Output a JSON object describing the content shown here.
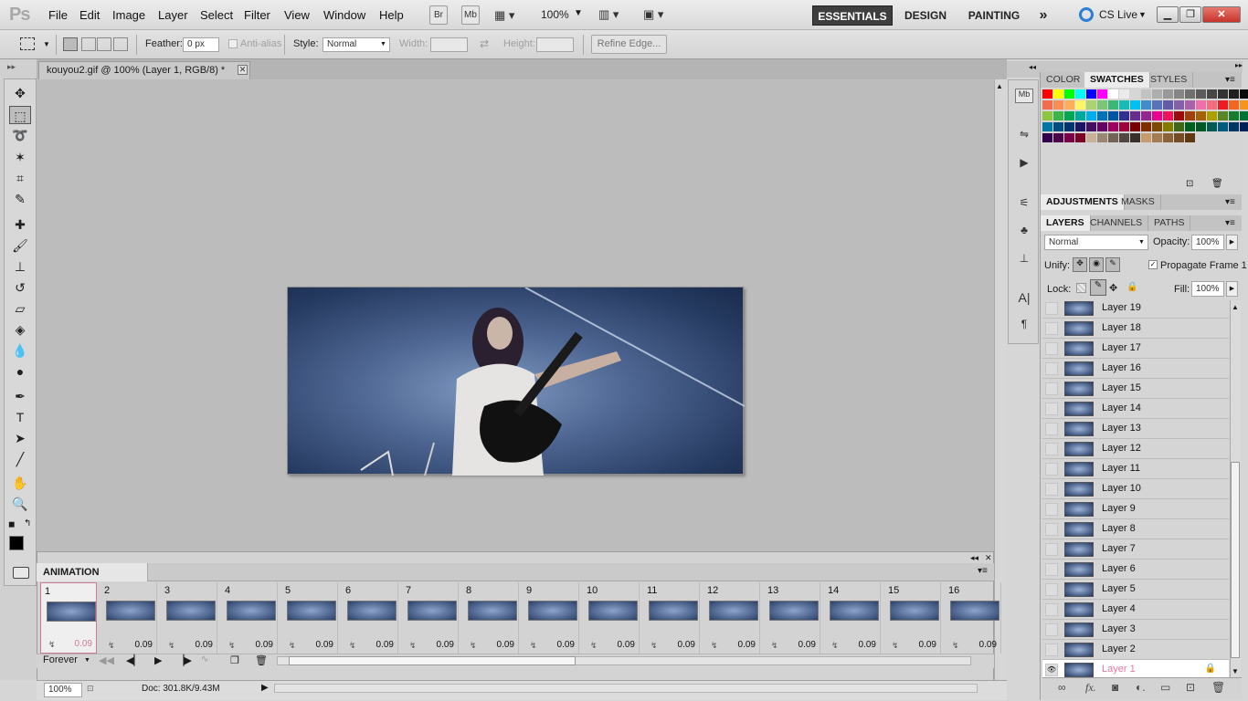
{
  "app": {
    "logo": "Ps"
  },
  "menu": {
    "items": [
      "File",
      "Edit",
      "Image",
      "Layer",
      "Select",
      "Filter",
      "View",
      "Window",
      "Help"
    ]
  },
  "appbar": {
    "bridge": "Br",
    "minibridge": "Mb",
    "zoom": "100%"
  },
  "workspaces": {
    "essentials": "ESSENTIALS",
    "design": "DESIGN",
    "painting": "PAINTING",
    "more": "»",
    "cslive": "CS Live"
  },
  "options": {
    "feather_label": "Feather:",
    "feather_value": "0 px",
    "antialias_label": "Anti-alias",
    "style_label": "Style:",
    "style_value": "Normal",
    "width_label": "Width:",
    "height_label": "Height:",
    "refine_edge": "Refine Edge..."
  },
  "document": {
    "tab_title": "kouyou2.gif @ 100% (Layer 1, RGB/8) *"
  },
  "status": {
    "zoom": "100%",
    "doc": "Doc: 301.8K/9.43M"
  },
  "animation": {
    "title": "ANIMATION (FRAMES)",
    "loop": "Forever",
    "frames": [
      {
        "n": "1",
        "delay": "0.09"
      },
      {
        "n": "2",
        "delay": "0.09"
      },
      {
        "n": "3",
        "delay": "0.09"
      },
      {
        "n": "4",
        "delay": "0.09"
      },
      {
        "n": "5",
        "delay": "0.09"
      },
      {
        "n": "6",
        "delay": "0.09"
      },
      {
        "n": "7",
        "delay": "0.09"
      },
      {
        "n": "8",
        "delay": "0.09"
      },
      {
        "n": "9",
        "delay": "0.09"
      },
      {
        "n": "10",
        "delay": "0.09"
      },
      {
        "n": "11",
        "delay": "0.09"
      },
      {
        "n": "12",
        "delay": "0.09"
      },
      {
        "n": "13",
        "delay": "0.09"
      },
      {
        "n": "14",
        "delay": "0.09"
      },
      {
        "n": "15",
        "delay": "0.09"
      },
      {
        "n": "16",
        "delay": "0.09"
      }
    ]
  },
  "panels": {
    "color_tab": "COLOR",
    "swatches_tab": "SWATCHES",
    "styles_tab": "STYLES",
    "adjustments_tab": "ADJUSTMENTS",
    "masks_tab": "MASKS",
    "layers_tab": "LAYERS",
    "channels_tab": "CHANNELS",
    "paths_tab": "PATHS"
  },
  "layers": {
    "blend_mode": "Normal",
    "opacity_label": "Opacity:",
    "opacity_value": "100%",
    "unify_label": "Unify:",
    "propagate_label": "Propagate Frame 1",
    "lock_label": "Lock:",
    "fill_label": "Fill:",
    "fill_value": "100%",
    "items": [
      "Layer 19",
      "Layer 18",
      "Layer 17",
      "Layer 16",
      "Layer 15",
      "Layer 14",
      "Layer 13",
      "Layer 12",
      "Layer 11",
      "Layer 10",
      "Layer 9",
      "Layer 8",
      "Layer 7",
      "Layer 6",
      "Layer 5",
      "Layer 4",
      "Layer 3",
      "Layer 2",
      "Layer 1"
    ],
    "active": "Layer 1"
  },
  "swatch_colors": [
    "#ff0000",
    "#ffff00",
    "#00ff00",
    "#00ffff",
    "#0000ff",
    "#ff00ff",
    "#ffffff",
    "#ebebeb",
    "#d6d6d6",
    "#c2c2c2",
    "#adadad",
    "#999999",
    "#858585",
    "#707070",
    "#5c5c5c",
    "#474747",
    "#333333",
    "#1f1f1f",
    "#0a0a0a",
    "#000000",
    "#f26c4f",
    "#f68e56",
    "#fbaf5d",
    "#fff568",
    "#acd372",
    "#7cc576",
    "#3bb878",
    "#1abbb4",
    "#00bff3",
    "#438ccb",
    "#5574b9",
    "#605ca8",
    "#855fa8",
    "#a763a8",
    "#f06eaa",
    "#f26d7d",
    "#ed1c24",
    "#f26522",
    "#f7941d",
    "#fff200",
    "#8dc63f",
    "#39b54a",
    "#00a651",
    "#00a99d",
    "#00aeef",
    "#0072bc",
    "#0054a6",
    "#2e3192",
    "#662d91",
    "#92278f",
    "#ec008c",
    "#ed145b",
    "#9e0b0f",
    "#a0410d",
    "#a36209",
    "#aba000",
    "#598527",
    "#197b30",
    "#007236",
    "#00746b",
    "#0076a3",
    "#004b80",
    "#003471",
    "#1b1464",
    "#440e62",
    "#630460",
    "#9e005d",
    "#9e0039",
    "#790000",
    "#7b2e00",
    "#7d4900",
    "#827b00",
    "#406618",
    "#005e20",
    "#005826",
    "#005952",
    "#005b7f",
    "#003663",
    "#002157",
    "#0d004c",
    "#32004b",
    "#4b0049",
    "#7b0046",
    "#7a0026",
    "#c7b299",
    "#998675",
    "#736357",
    "#534741",
    "#37302d",
    "#c69c6d",
    "#a67c52",
    "#8c6239",
    "#754c24",
    "#603913"
  ]
}
